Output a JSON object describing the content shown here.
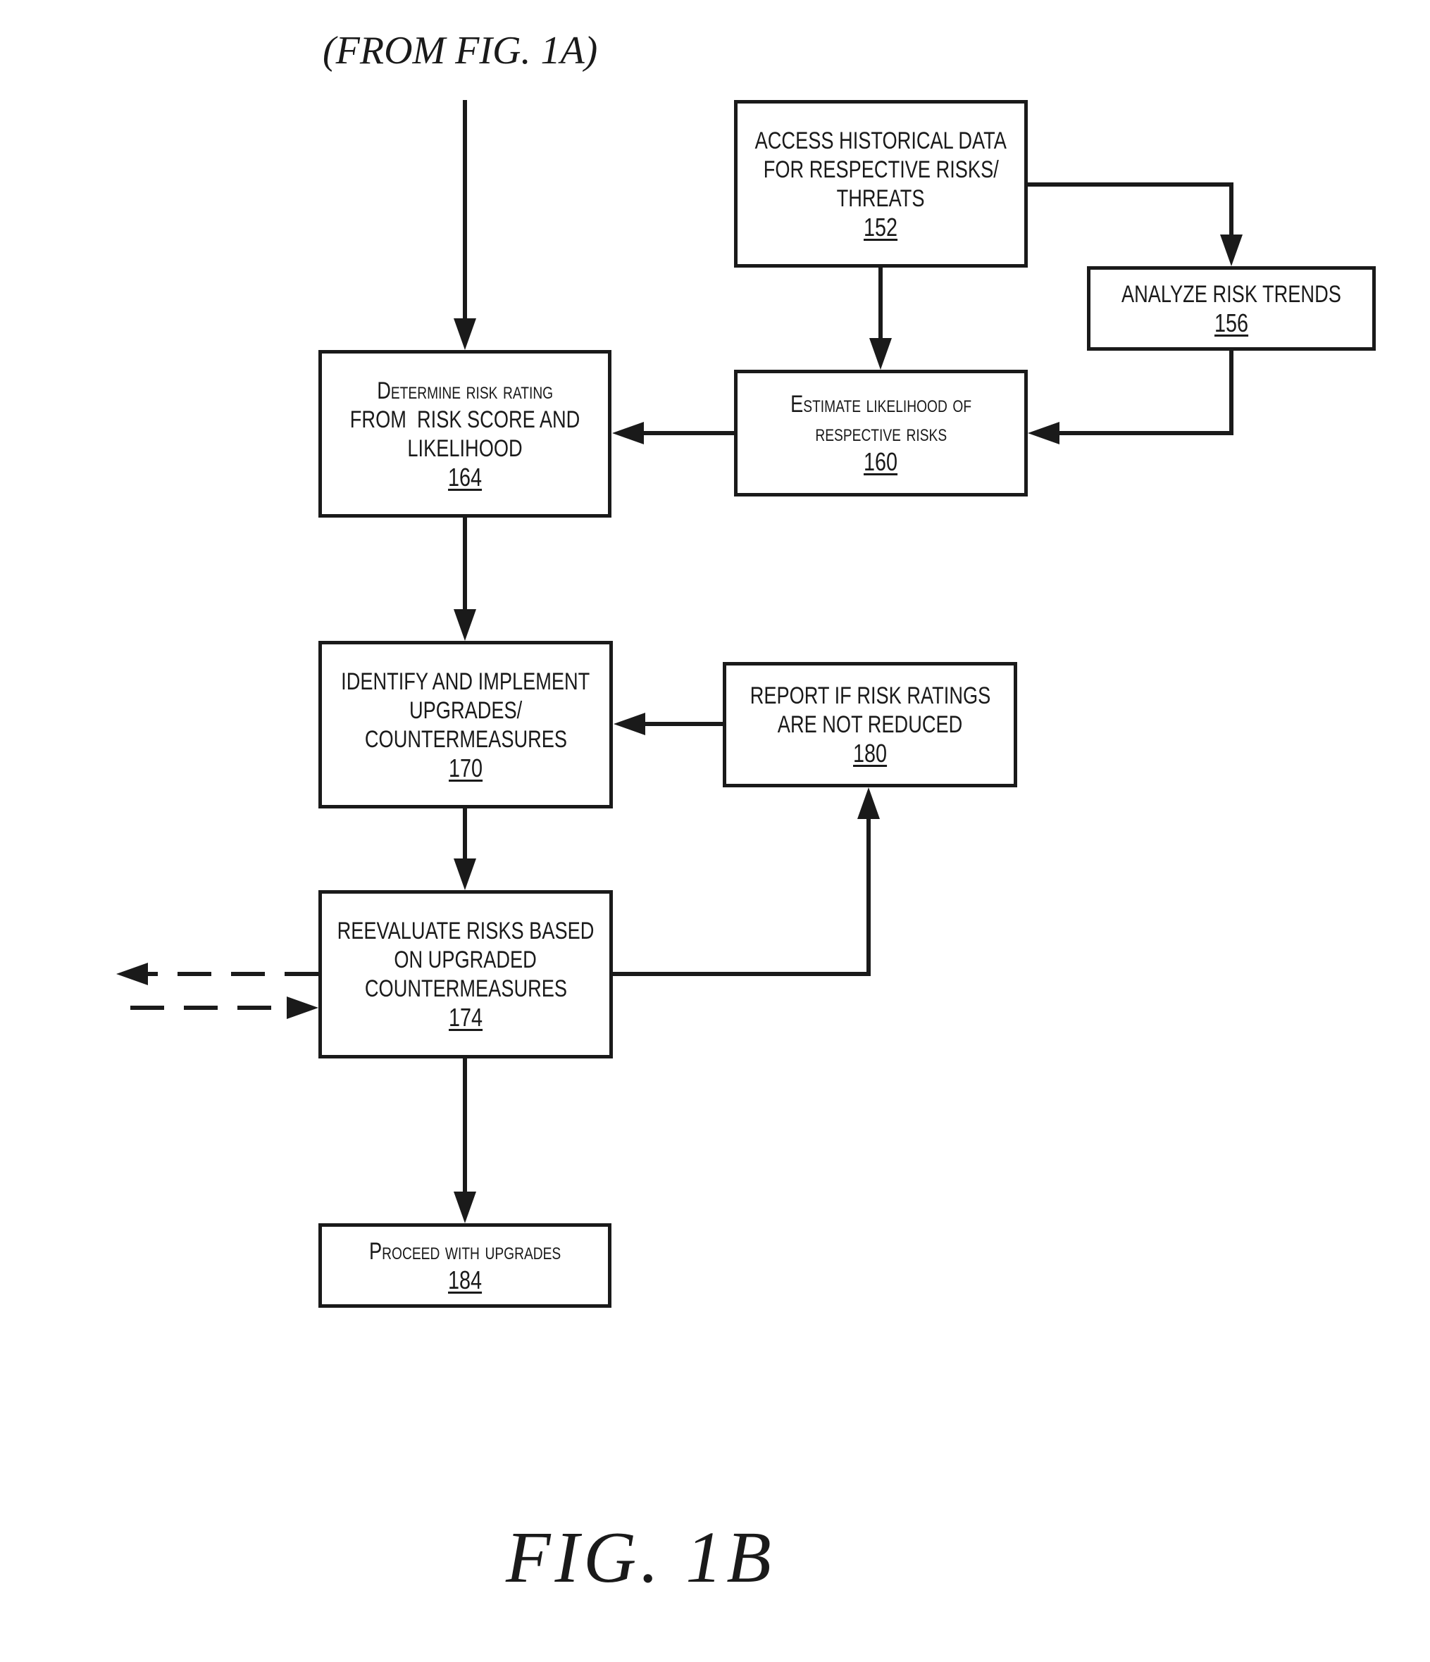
{
  "figure": {
    "from_label": "(FROM FIG. 1A)",
    "title": "FIG. 1B"
  },
  "boxes": {
    "b152": {
      "lines": [
        "ACCESS HISTORICAL DATA",
        "FOR RESPECTIVE RISKS/",
        "THREATS"
      ],
      "ref": "152"
    },
    "b156": {
      "lines": [
        "ANALYZE RISK TRENDS"
      ],
      "ref": "156"
    },
    "b160": {
      "lines": [
        "Estimate likelihood of",
        "respective risks"
      ],
      "ref": "160"
    },
    "b164": {
      "lines": [
        "Determine risk rating",
        "from  risk score and",
        "likelihood"
      ],
      "ref": "164"
    },
    "b170": {
      "lines": [
        "IDENTIFY AND IMPLEMENT",
        "UPGRADES/",
        "COUNTERMEASURES"
      ],
      "ref": "170"
    },
    "b180": {
      "lines": [
        "REPORT IF RISK RATINGS",
        "ARE NOT REDUCED"
      ],
      "ref": "180"
    },
    "b174": {
      "lines": [
        "REEVALUATE RISKS BASED",
        "ON UPGRADED",
        "COUNTERMEASURES"
      ],
      "ref": "174"
    },
    "b184": {
      "lines": [
        "Proceed with upgrades"
      ],
      "ref": "184"
    }
  },
  "connections": [
    {
      "from": "FIG. 1A",
      "to": "164",
      "style": "solid"
    },
    {
      "from": "152",
      "to": "160",
      "style": "solid"
    },
    {
      "from": "152",
      "to": "156",
      "style": "solid"
    },
    {
      "from": "156",
      "to": "160",
      "style": "solid"
    },
    {
      "from": "160",
      "to": "164",
      "style": "solid"
    },
    {
      "from": "164",
      "to": "170",
      "style": "solid"
    },
    {
      "from": "180",
      "to": "170",
      "style": "solid"
    },
    {
      "from": "170",
      "to": "174",
      "style": "solid"
    },
    {
      "from": "174",
      "to": "180",
      "style": "solid"
    },
    {
      "from": "174",
      "to": "184",
      "style": "solid"
    },
    {
      "from": "174",
      "to": "external-left",
      "style": "dashed"
    },
    {
      "from": "external-left",
      "to": "174",
      "style": "dashed"
    }
  ]
}
